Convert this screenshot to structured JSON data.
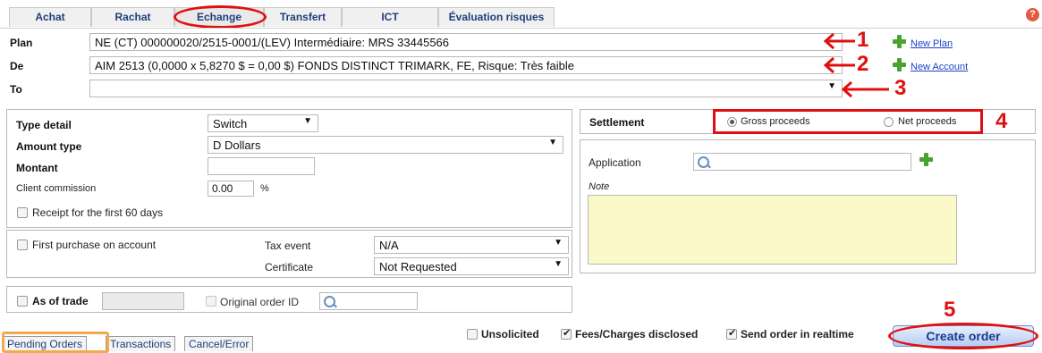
{
  "tabs": [
    "Achat",
    "Rachat",
    "Echange",
    "Transfert",
    "ICT",
    "Évaluation risques"
  ],
  "header": {
    "plan_label": "Plan",
    "plan_value": "NE (CT) 000000020/2515-0001/(LEV) Intermédiaire: MRS 33445566",
    "new_plan": "New Plan",
    "de_label": "De",
    "de_value": "AIM 2513 (0,0000 x 5,8270 $ = 0,00 $) FONDS DISTINCT TRIMARK, FE, Risque: Très faible",
    "new_account": "New Account",
    "to_label": "To",
    "to_value": ""
  },
  "left_panel": {
    "type_detail_label": "Type detail",
    "type_detail_value": "Switch",
    "amount_type_label": "Amount type",
    "amount_type_value": "D Dollars",
    "montant_label": "Montant",
    "montant_value": "",
    "client_commission_label": "Client commission",
    "client_commission_value": "0.00",
    "percent": "%",
    "receipt_label": "Receipt for the first 60 days"
  },
  "first_purchase": {
    "label": "First purchase on account",
    "tax_event_label": "Tax event",
    "tax_event_value": "N/A",
    "certificate_label": "Certificate",
    "certificate_value": "Not Requested"
  },
  "trade": {
    "as_of_trade_label": "As of trade",
    "original_order_label": "Original order ID"
  },
  "settlement": {
    "label": "Settlement",
    "gross": "Gross proceeds",
    "net": "Net proceeds",
    "selected": "Gross proceeds"
  },
  "right_panel": {
    "application_label": "Application",
    "note_label": "Note"
  },
  "bottom_tabs": [
    "Pending Orders",
    "Transactions",
    "Cancel/Error"
  ],
  "footer": {
    "unsolicited": "Unsolicited",
    "fees": "Fees/Charges disclosed",
    "send_realtime": "Send order in realtime",
    "create_order": "Create order"
  },
  "annotations": [
    "1",
    "2",
    "3",
    "4",
    "5"
  ],
  "colors": {
    "accent": "#1f3f7a",
    "annotation": "#e01010",
    "note_bg": "#fbf9c7",
    "add": "#4aa32e"
  }
}
